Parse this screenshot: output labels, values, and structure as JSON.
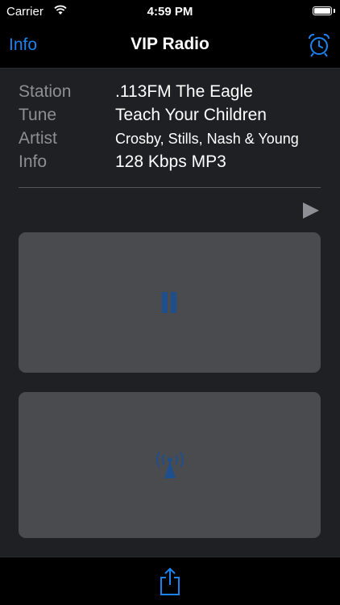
{
  "status_bar": {
    "carrier": "Carrier",
    "time": "4:59 PM",
    "wifi_icon": "wifi-icon",
    "battery_icon": "battery-icon"
  },
  "nav": {
    "info_label": "Info",
    "title": "VIP Radio",
    "alarm_icon": "alarm-clock-icon",
    "accent_color": "#1b83f0"
  },
  "track_info": {
    "rows": [
      {
        "label": "Station",
        "value": ".113FM The Eagle"
      },
      {
        "label": "Tune",
        "value": "Teach Your Children"
      },
      {
        "label": "Artist",
        "value": "Crosby, Stills, Nash & Young"
      },
      {
        "label": "Info",
        "value": "128 Kbps MP3"
      }
    ]
  },
  "controls": {
    "play_icon": "play-icon",
    "pause_icon": "pause-icon",
    "broadcast_icon": "broadcast-tower-icon",
    "icon_color": "#1e4f8c"
  },
  "toolbar": {
    "share_icon": "share-icon"
  }
}
